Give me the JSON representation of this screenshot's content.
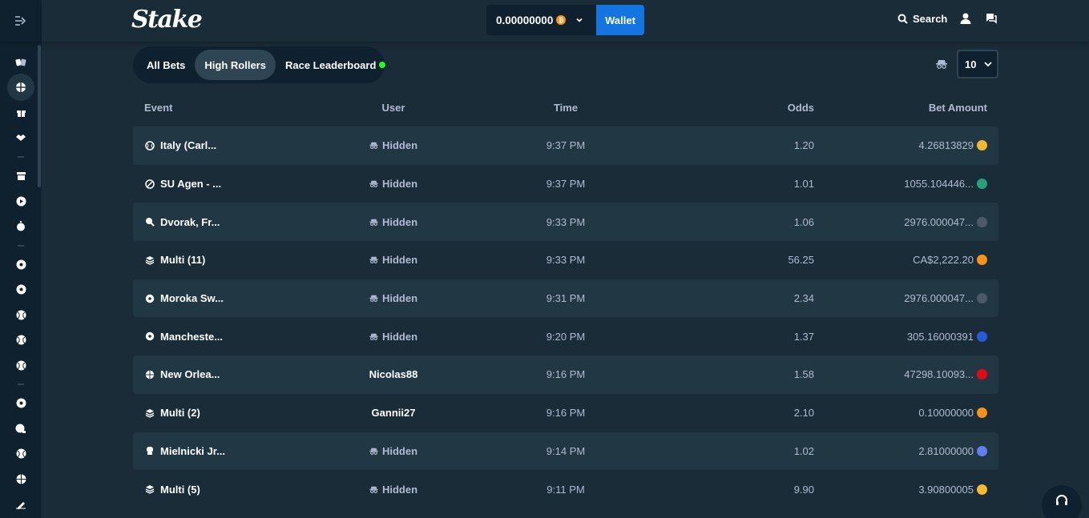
{
  "app": {
    "logo": "Stake"
  },
  "topbar": {
    "balance": "0.00000000",
    "balance_currency_color": "#f7931a",
    "wallet_label": "Wallet",
    "search_label": "Search"
  },
  "tabs": [
    {
      "label": "All Bets",
      "active": false
    },
    {
      "label": "High Rollers",
      "active": true
    },
    {
      "label": "Race Leaderboard",
      "active": false,
      "live_dot": true
    }
  ],
  "page_size": "10",
  "table": {
    "headers": {
      "event": "Event",
      "user": "User",
      "time": "Time",
      "odds": "Odds",
      "amount": "Bet Amount"
    },
    "rows": [
      {
        "event": "Italy (Carl...",
        "event_icon": "tennis-icon",
        "user": "Hidden",
        "hidden": true,
        "time": "9:37 PM",
        "odds": "1.20",
        "amount": "4.26813829",
        "coin_color": "#f3ba2f",
        "coin_icon": "bnb-coin-icon"
      },
      {
        "event": "SU Agen - ...",
        "event_icon": "football-icon",
        "user": "Hidden",
        "hidden": true,
        "time": "9:37 PM",
        "odds": "1.01",
        "amount": "1055.104446...",
        "coin_color": "#26a17b",
        "coin_icon": "tether-coin-icon"
      },
      {
        "event": "Dvorak, Fr...",
        "event_icon": "table-tennis-icon",
        "user": "Hidden",
        "hidden": true,
        "time": "9:33 PM",
        "odds": "1.06",
        "amount": "2976.000047...",
        "coin_color": "#4b5a66",
        "coin_icon": "xrp-coin-icon"
      },
      {
        "event": "Multi (11)",
        "event_icon": "multi-icon",
        "user": "Hidden",
        "hidden": true,
        "time": "9:33 PM",
        "odds": "56.25",
        "amount": "CA$2,222.20",
        "coin_color": "#f7931a",
        "coin_icon": "dollar-coin-icon"
      },
      {
        "event": "Moroka Sw...",
        "event_icon": "soccer-icon",
        "user": "Hidden",
        "hidden": true,
        "time": "9:31 PM",
        "odds": "2.34",
        "amount": "2976.000047...",
        "coin_color": "#4b5a66",
        "coin_icon": "xrp-coin-icon"
      },
      {
        "event": "Mancheste...",
        "event_icon": "soccer-icon",
        "user": "Hidden",
        "hidden": true,
        "time": "9:20 PM",
        "odds": "1.37",
        "amount": "305.16000391",
        "coin_color": "#2a5ada",
        "coin_icon": "link-coin-icon"
      },
      {
        "event": "New Orlea...",
        "event_icon": "basketball-icon",
        "user": "Nicolas88",
        "hidden": false,
        "time": "9:16 PM",
        "odds": "1.58",
        "amount": "47298.10093...",
        "coin_color": "#e50915",
        "coin_icon": "tron-coin-icon"
      },
      {
        "event": "Multi (2)",
        "event_icon": "multi-icon",
        "user": "Gannii27",
        "hidden": false,
        "time": "9:16 PM",
        "odds": "2.10",
        "amount": "0.10000000",
        "coin_color": "#f7931a",
        "coin_icon": "bitcoin-coin-icon"
      },
      {
        "event": "Mielnicki Jr...",
        "event_icon": "boxing-icon",
        "user": "Hidden",
        "hidden": true,
        "time": "9:14 PM",
        "odds": "1.02",
        "amount": "2.81000000",
        "coin_color": "#627eea",
        "coin_icon": "ethereum-coin-icon"
      },
      {
        "event": "Multi (5)",
        "event_icon": "multi-icon",
        "user": "Hidden",
        "hidden": true,
        "time": "9:11 PM",
        "odds": "9.90",
        "amount": "3.90800005",
        "coin_color": "#f3ba2f",
        "coin_icon": "bnb-coin-icon"
      }
    ]
  }
}
